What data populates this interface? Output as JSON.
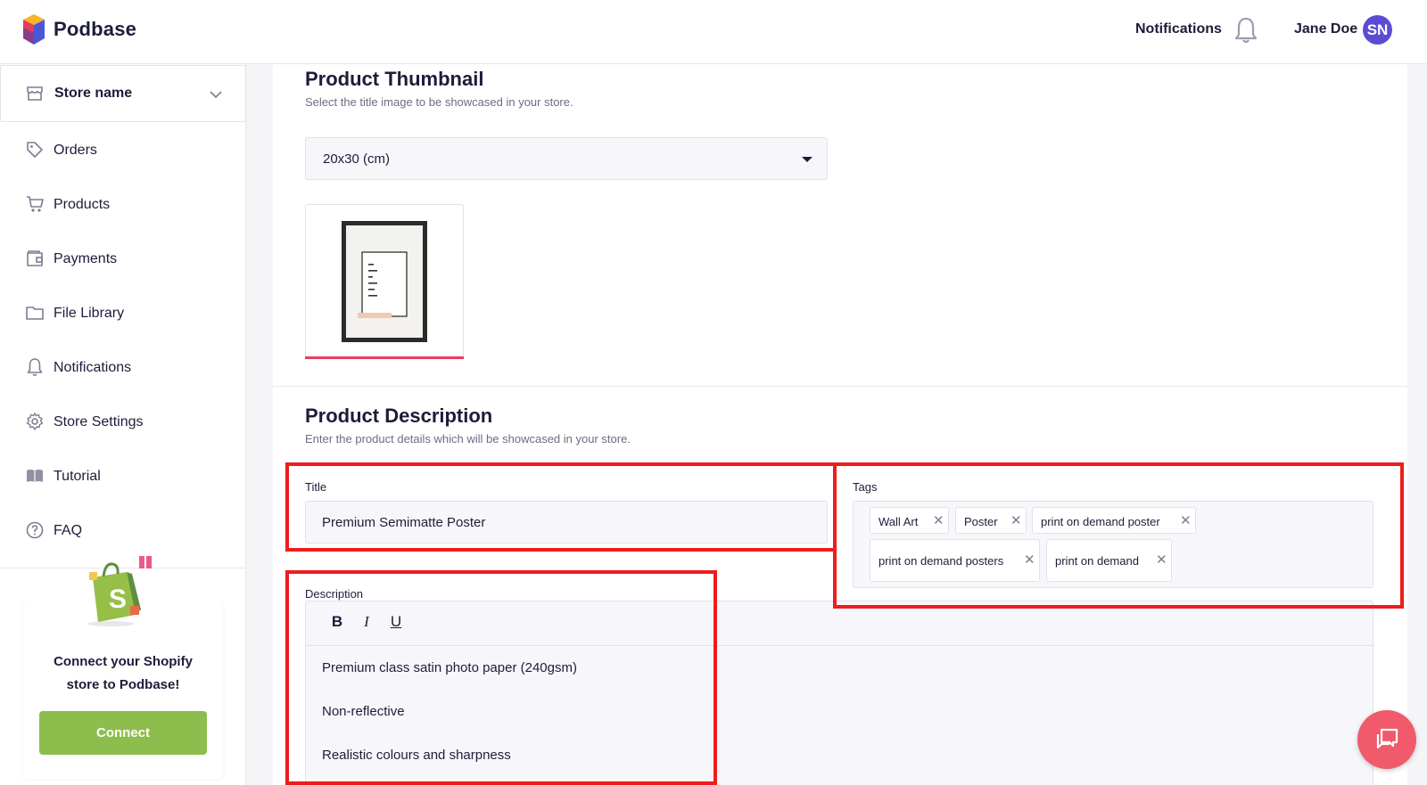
{
  "header": {
    "brand": "Podbase",
    "notifications_label": "Notifications",
    "user_name": "Jane Doe",
    "avatar_initials": "SN"
  },
  "sidebar": {
    "store_select_label": "Store name",
    "items": [
      {
        "label": "Orders",
        "icon": "tag-icon"
      },
      {
        "label": "Products",
        "icon": "cart-icon"
      },
      {
        "label": "Payments",
        "icon": "wallet-icon"
      },
      {
        "label": "File Library",
        "icon": "folder-icon"
      },
      {
        "label": "Notifications",
        "icon": "bell-icon"
      },
      {
        "label": "Store Settings",
        "icon": "gear-icon"
      },
      {
        "label": "Tutorial",
        "icon": "book-icon"
      },
      {
        "label": "FAQ",
        "icon": "help-icon"
      }
    ],
    "connect": {
      "text_line1": "Connect your Shopify",
      "text_line2": "store to Podbase!",
      "button": "Connect"
    }
  },
  "thumbnail": {
    "title": "Product Thumbnail",
    "subtitle": "Select the title image to be showcased in your store.",
    "size_value": "20x30 (cm)"
  },
  "description_section": {
    "title": "Product Description",
    "subtitle": "Enter the product details which will be showcased in your store.",
    "title_label": "Title",
    "title_value": "Premium Semimatte Poster",
    "tags_label": "Tags",
    "tags": [
      "Wall Art",
      "Poster",
      "print on demand poster",
      "print on demand posters",
      "print on demand"
    ],
    "description_label": "Description",
    "toolbar": {
      "bold": "B",
      "italic": "I",
      "underline": "U"
    },
    "description_lines": [
      "Premium class satin photo paper (240gsm)",
      "Non-reflective",
      "Realistic colours and sharpness"
    ]
  },
  "colors": {
    "accent": "#5b4cd6",
    "connect_green": "#8dbd4d",
    "annotation_red": "#ee1c1c",
    "chat_pink": "#f15a6a"
  }
}
